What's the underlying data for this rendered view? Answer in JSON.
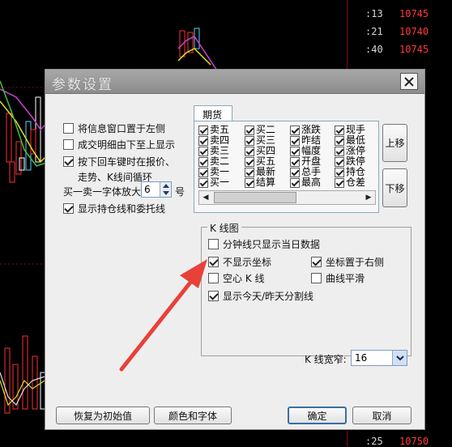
{
  "dialog": {
    "title": "参数设置",
    "options_left": [
      {
        "label": "将信息窗口置于左侧",
        "checked": false
      },
      {
        "label": "成交明细由下至上显示",
        "checked": false
      },
      {
        "label": "按下回车键时在报价、",
        "checked": true
      }
    ],
    "enter_cont": "走势、K线间循环",
    "font_zoom": {
      "label": "买一卖一字体放大",
      "value": "6",
      "suffix": "号"
    },
    "show_positions": {
      "label": "显示持仓线和委托线",
      "checked": true
    },
    "futures_tab": {
      "label": "期货",
      "columns": [
        [
          {
            "label": "卖五",
            "checked": true
          },
          {
            "label": "卖四",
            "checked": true
          },
          {
            "label": "卖三",
            "checked": true
          },
          {
            "label": "卖二",
            "checked": true
          },
          {
            "label": "卖一",
            "checked": true
          },
          {
            "label": "买一",
            "checked": true
          }
        ],
        [
          {
            "label": "买二",
            "checked": true
          },
          {
            "label": "买三",
            "checked": true
          },
          {
            "label": "买四",
            "checked": true
          },
          {
            "label": "买五",
            "checked": true
          },
          {
            "label": "最新",
            "checked": true
          },
          {
            "label": "结算",
            "checked": true
          }
        ],
        [
          {
            "label": "涨跌",
            "checked": true
          },
          {
            "label": "昨结",
            "checked": true
          },
          {
            "label": "幅度",
            "checked": true
          },
          {
            "label": "开盘",
            "checked": true
          },
          {
            "label": "总手",
            "checked": true
          },
          {
            "label": "最高",
            "checked": true
          }
        ],
        [
          {
            "label": "现手",
            "checked": true
          },
          {
            "label": "最低",
            "checked": true
          },
          {
            "label": "涨停",
            "checked": true
          },
          {
            "label": "跌停",
            "checked": true
          },
          {
            "label": "持仓",
            "checked": true
          },
          {
            "label": "仓差",
            "checked": true
          }
        ]
      ],
      "move_up": "上移",
      "move_down": "下移"
    },
    "kline": {
      "group_title": "K 线图",
      "minute_today": {
        "label": "分钟线只显示当日数据",
        "checked": false
      },
      "hide_axis": {
        "label": "不显示坐标",
        "checked": true
      },
      "axis_right": {
        "label": "坐标置于右侧",
        "checked": true
      },
      "hollow": {
        "label": "空心 K 线",
        "checked": false
      },
      "smooth": {
        "label": "曲线平滑",
        "checked": false
      },
      "day_split": {
        "label": "显示今天/昨天分割线",
        "checked": true
      },
      "width_label": "K 线宽窄:",
      "width_value": "16"
    },
    "buttons": {
      "reset": "恢复为初始值",
      "colors_fonts": "颜色和字体",
      "ok": "确定",
      "cancel": "取消"
    }
  },
  "quotes": [
    {
      "time": ":13",
      "price": "10745"
    },
    {
      "time": ":21",
      "price": "10740"
    },
    {
      "time": ":40",
      "price": "10745"
    },
    {
      "time": ":25",
      "price": "10750"
    }
  ],
  "colors": {
    "price": "#ff3b3b",
    "annotation_arrow": "#e8413a"
  }
}
